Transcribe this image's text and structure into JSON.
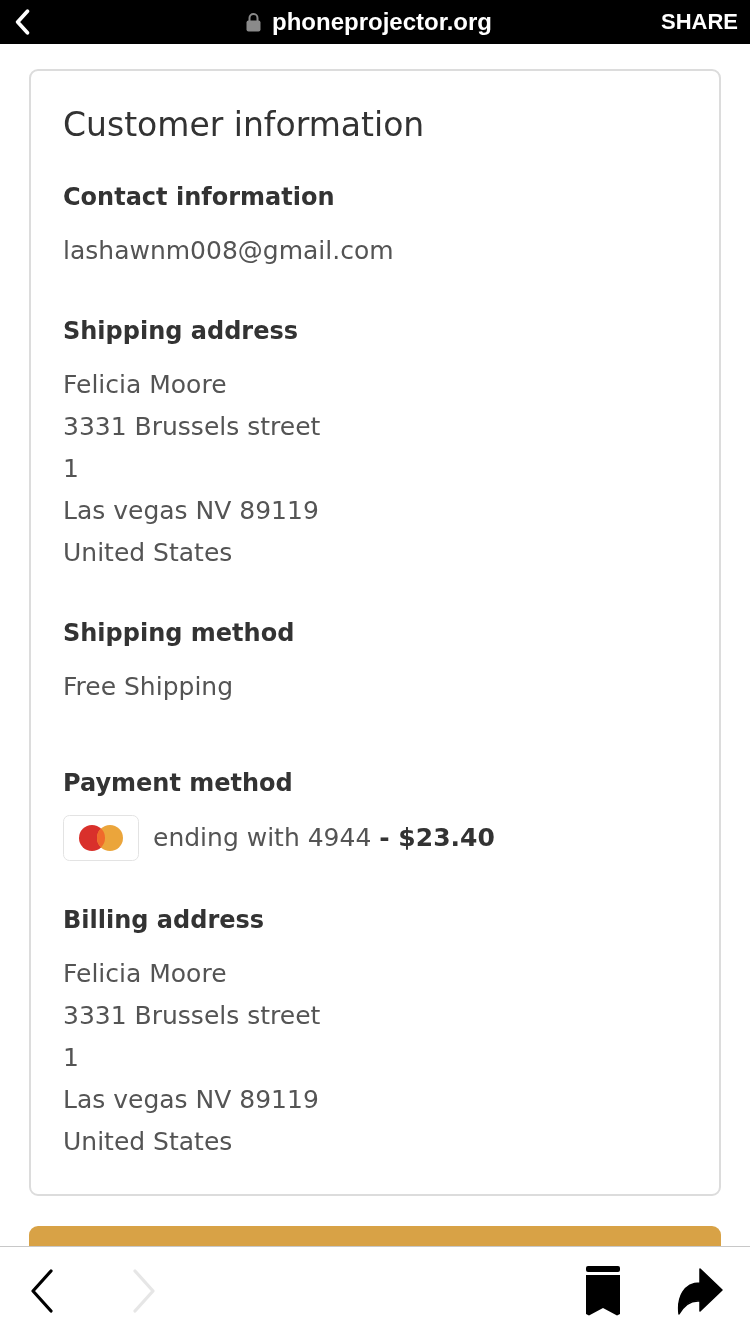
{
  "top_bar": {
    "secure": true,
    "domain": "phoneprojector.org",
    "share_label": "SHARE"
  },
  "card": {
    "title": "Customer information",
    "sections": [
      {
        "kind": "lines",
        "heading": "Contact information",
        "lines": [
          "lashawnm008@gmail.com"
        ]
      },
      {
        "kind": "lines",
        "heading": "Shipping address",
        "lines": [
          "Felicia Moore",
          "3331 Brussels street",
          "1",
          "Las vegas NV 89119",
          "United States"
        ]
      },
      {
        "kind": "method",
        "heading": "Shipping method",
        "lines": [
          "Free Shipping"
        ]
      },
      {
        "kind": "payment",
        "heading": "Payment method",
        "text": "ending with 4944 **- $23.40**"
      },
      {
        "kind": "lines",
        "heading": "Billing address",
        "lines": [
          "Felicia Moore",
          "3331 Brussels street",
          "1",
          "Las vegas NV 89119",
          "United States"
        ]
      }
    ]
  },
  "toolbar": {
    "back": {
      "disabled": false
    },
    "forward": {
      "disabled": true
    }
  }
}
